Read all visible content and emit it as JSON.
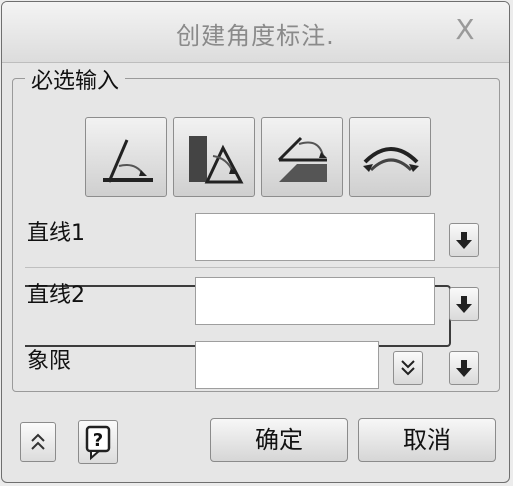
{
  "window": {
    "title": "创建角度标注.",
    "close_label": "X"
  },
  "required_group": {
    "label": "必选输入"
  },
  "tools": [
    {
      "name": "angle-line-line-icon"
    },
    {
      "name": "angle-face-line-icon"
    },
    {
      "name": "angle-face-face-icon"
    },
    {
      "name": "arc-angle-icon"
    }
  ],
  "rows": [
    {
      "label": "直线1",
      "value": ""
    },
    {
      "label": "直线2",
      "value": ""
    },
    {
      "label": "象限",
      "value": ""
    }
  ],
  "footer": {
    "ok_label": "确定",
    "cancel_label": "取消"
  }
}
